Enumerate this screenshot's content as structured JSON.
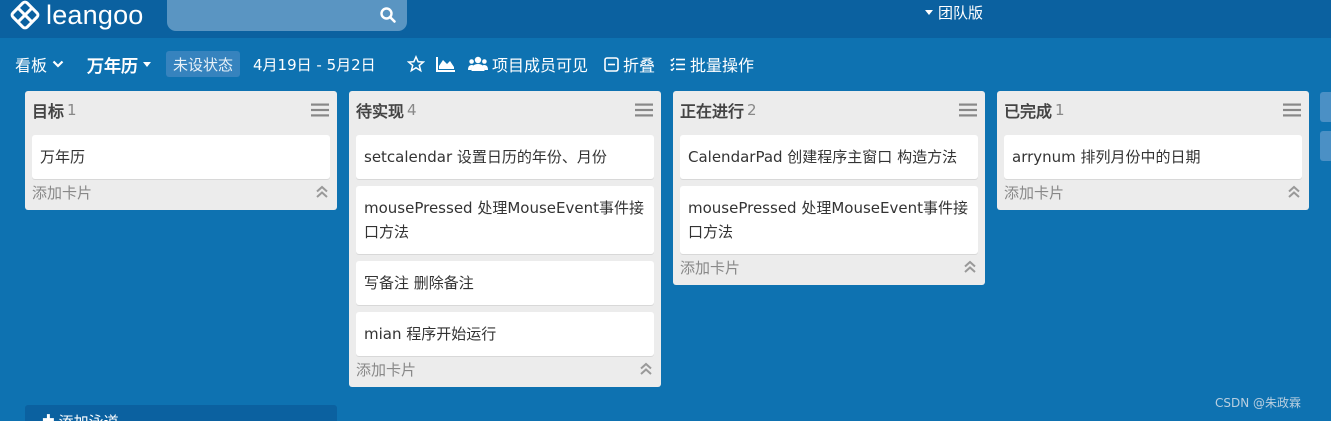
{
  "topbar": {
    "logo_text": "leangoo",
    "search": {
      "value": "",
      "placeholder": ""
    },
    "edition_label": "团队版"
  },
  "boardbar": {
    "view_label": "看板",
    "board_title": "万年历",
    "status_badge": "未设状态",
    "date_range": "4月19日 - 5月2日",
    "members_label": "项目成员可见",
    "fold_label": "折叠",
    "batch_label": "批量操作"
  },
  "lists": [
    {
      "title": "目标",
      "count": "1",
      "cards": [
        "万年历"
      ],
      "add_card_label": "添加卡片"
    },
    {
      "title": "待实现",
      "count": "4",
      "cards": [
        "setcalendar 设置日历的年份、月份",
        "mousePressed 处理MouseEvent事件接口方法",
        "写备注 删除备注",
        "mian 程序开始运行"
      ],
      "add_card_label": "添加卡片"
    },
    {
      "title": "正在进行",
      "count": "2",
      "cards": [
        "CalendarPad 创建程序主窗口 构造方法",
        "mousePressed 处理MouseEvent事件接口方法"
      ],
      "add_card_label": "添加卡片"
    },
    {
      "title": "已完成",
      "count": "1",
      "cards": [
        "arrynum 排列月份中的日期"
      ],
      "add_card_label": "添加卡片"
    }
  ],
  "add_lane_label": "添加泳道",
  "watermark": "CSDN @朱政霖",
  "colors": {
    "background": "#0e72b1",
    "topbar": "#0b61a0",
    "list": "#ececec",
    "card": "#ffffff"
  }
}
